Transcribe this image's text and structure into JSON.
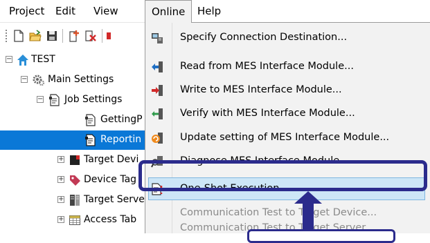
{
  "menubar": {
    "items": [
      {
        "label": "Project"
      },
      {
        "label": "Edit"
      },
      {
        "label": "View"
      },
      {
        "label": "Online"
      },
      {
        "label": "Help"
      }
    ]
  },
  "tree": {
    "items": [
      {
        "label": "TEST",
        "icon": "home-icon"
      },
      {
        "label": "Main Settings",
        "icon": "gears-icon"
      },
      {
        "label": "Job Settings",
        "icon": "job-document-icon"
      },
      {
        "label": "GettingP",
        "icon": "job-document-icon"
      },
      {
        "label": "Reportin",
        "icon": "job-document-icon"
      },
      {
        "label": "Target Devi",
        "icon": "device-icon"
      },
      {
        "label": "Device Tag",
        "icon": "tag-icon"
      },
      {
        "label": "Target Serve",
        "icon": "server-icon"
      },
      {
        "label": "Access Tab",
        "icon": "table-icon"
      }
    ]
  },
  "dropdown": {
    "items": [
      {
        "label": "Specify Connection Destination...",
        "icon": "connection-icon",
        "enabled": true
      },
      {
        "label": "Read from MES Interface Module...",
        "icon": "read-arrow-icon",
        "enabled": true
      },
      {
        "label": "Write to MES Interface Module...",
        "icon": "write-arrow-icon",
        "enabled": true
      },
      {
        "label": "Verify with MES Interface Module...",
        "icon": "verify-arrow-icon",
        "enabled": true
      },
      {
        "label": "Update setting of MES Interface Module...",
        "icon": "update-icon",
        "enabled": true
      },
      {
        "label": "Diagnose MES Interface Module...",
        "icon": "diagnose-icon",
        "enabled": true
      },
      {
        "label": "One-Shot Execution...",
        "icon": "one-shot-icon",
        "enabled": true,
        "highlighted": true
      },
      {
        "label": "Communication Test to Target Device...",
        "icon": "",
        "enabled": false
      },
      {
        "label": "Communication Test to Target Server...",
        "icon": "",
        "enabled": false
      }
    ]
  },
  "colors": {
    "selection": "#0a78d7",
    "highlight": "#cde6f7",
    "annotation": "#2b2b8c"
  }
}
